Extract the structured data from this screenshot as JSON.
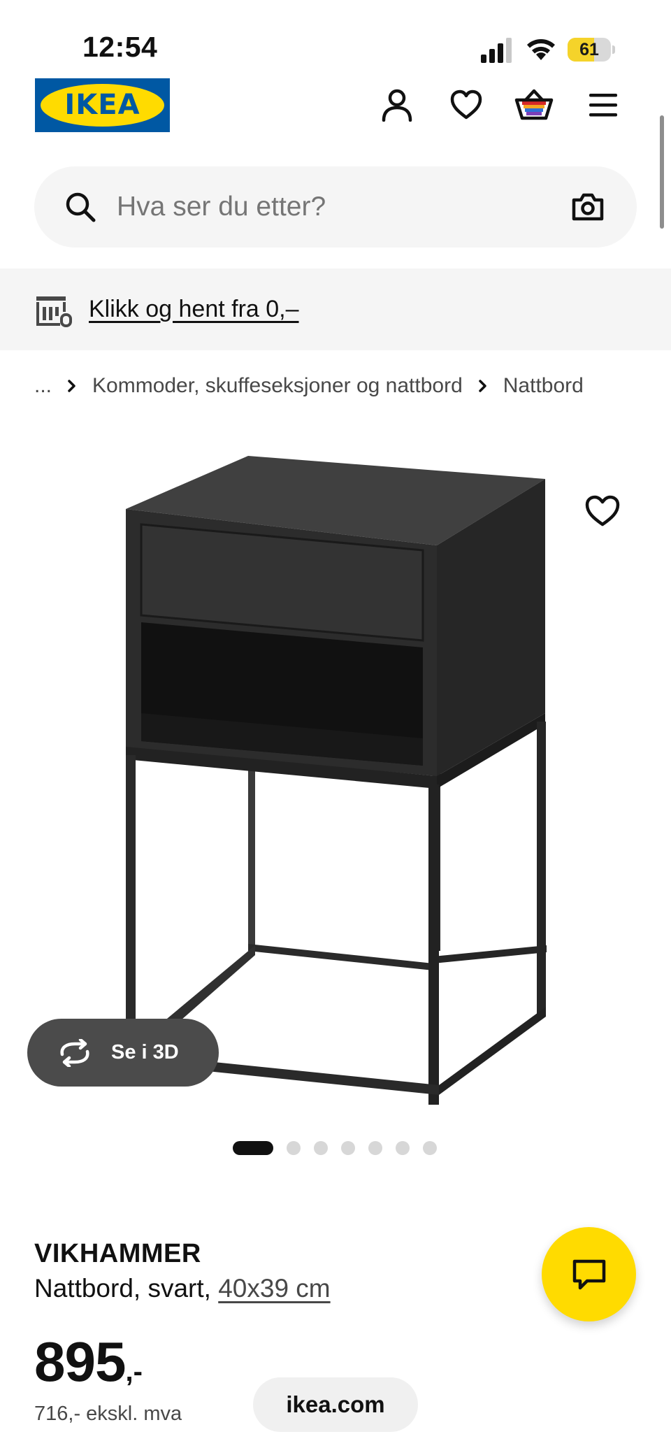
{
  "status_bar": {
    "time": "12:54",
    "battery_level": "61",
    "battery_fraction": 0.61,
    "signal_bars": 3,
    "icons": [
      "cellular-signal-icon",
      "wifi-icon",
      "battery-icon"
    ]
  },
  "header": {
    "logo_text": "IKEA",
    "icons": [
      "account-icon",
      "heart-icon",
      "shopping-bag-icon",
      "hamburger-menu-icon"
    ]
  },
  "search": {
    "placeholder": "Hva ser du etter?",
    "icons": [
      "search-icon",
      "camera-icon"
    ]
  },
  "banner": {
    "text": "Klikk og hent fra 0,–",
    "icon": "click-and-collect-store-icon"
  },
  "breadcrumb": {
    "ellipsis": "...",
    "items": [
      "Kommoder, skuffeseksjoner og nattbord",
      "Nattbord"
    ]
  },
  "gallery": {
    "view_3d_label": "Se i 3D",
    "slide_count": 7,
    "active_slide": 1
  },
  "product": {
    "name": "VIKHAMMER",
    "description": "Nattbord, svart, ",
    "size": "40x39 cm",
    "price": "895",
    "price_suffix": ",-",
    "price_ex_vat": "716,- ekskl. mva"
  },
  "browser": {
    "url": "ikea.com"
  },
  "colors": {
    "brand_blue": "#0058a3",
    "brand_yellow": "#ffdb00",
    "text": "#111111",
    "secondary_text": "#484848",
    "light_background": "#f5f5f5"
  }
}
